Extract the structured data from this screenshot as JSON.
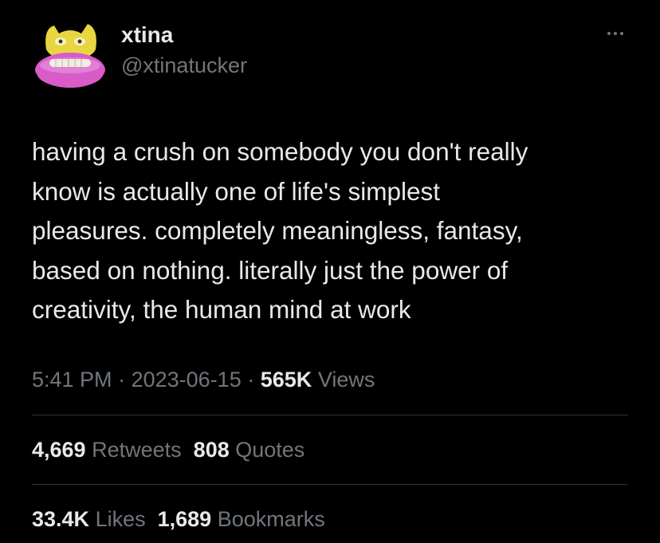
{
  "tweet": {
    "display_name": "xtina",
    "handle": "@xtinatucker",
    "avatar_icon": "cartoon-face-avatar",
    "more_icon": "more-dots-icon",
    "text": "having a crush on somebody you don't really\nknow is actually one of life's simplest\npleasures. completely meaningless, fantasy,\nbased on nothing. literally just the power of\ncreativity, the human mind at work",
    "time": "5:41 PM",
    "date": "2023-06-15",
    "separator": "·",
    "views_count": "565K",
    "views_label": "Views",
    "retweets_count": "4,669",
    "retweets_label": "Retweets",
    "quotes_count": "808",
    "quotes_label": "Quotes",
    "likes_count": "33.4K",
    "likes_label": "Likes",
    "bookmarks_count": "1,689",
    "bookmarks_label": "Bookmarks"
  },
  "colors": {
    "background": "#000000",
    "primary_text": "#e7e9ea",
    "secondary_text": "#71767b",
    "divider": "#2f3336"
  }
}
